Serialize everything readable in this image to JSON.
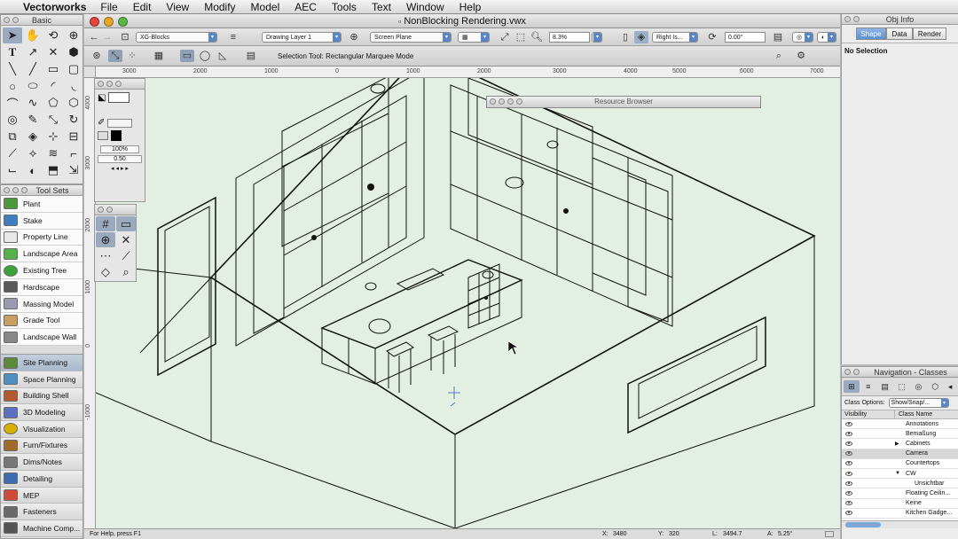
{
  "menubar": {
    "app": "Vectorworks",
    "items": [
      "File",
      "Edit",
      "View",
      "Modify",
      "Model",
      "AEC",
      "Tools",
      "Text",
      "Window",
      "Help"
    ]
  },
  "basic_palette": {
    "title": "Basic"
  },
  "toolsets_palette": {
    "title": "Tool Sets",
    "tools": [
      {
        "label": "Plant",
        "color": "#4a9a3c"
      },
      {
        "label": "Stake",
        "color": "#3f7fbf"
      },
      {
        "label": "Property Line",
        "color": "#7a7a7a"
      },
      {
        "label": "Landscape Area",
        "color": "#54b24a"
      },
      {
        "label": "Existing Tree",
        "color": "#3da23a"
      },
      {
        "label": "Hardscape",
        "color": "#5a5a5a"
      },
      {
        "label": "Massing Model",
        "color": "#9a9ab0"
      },
      {
        "label": "Grade Tool",
        "color": "#8a6a3a"
      },
      {
        "label": "Landscape Wall",
        "color": "#888888"
      }
    ],
    "sets": [
      {
        "label": "Site Planning",
        "active": true,
        "color": "#5c8a3a"
      },
      {
        "label": "Space Planning",
        "color": "#4f8fbf"
      },
      {
        "label": "Building Shell",
        "color": "#b3582f"
      },
      {
        "label": "3D Modeling",
        "color": "#5d6fbf"
      },
      {
        "label": "Visualization",
        "color": "#d8b000"
      },
      {
        "label": "Furn/Fixtures",
        "color": "#a06a2a"
      },
      {
        "label": "Dims/Notes",
        "color": "#777777"
      },
      {
        "label": "Detailing",
        "color": "#3d6db0"
      },
      {
        "label": "MEP",
        "color": "#d04a3a"
      },
      {
        "label": "Fasteners",
        "color": "#6a6a6a"
      },
      {
        "label": "Machine Comp...",
        "color": "#555555"
      }
    ]
  },
  "attributes": {
    "zoom_value": "100%",
    "line_weight": "0.50"
  },
  "document": {
    "title": "NonBlocking Rendering.vwx",
    "class_popup": "XG-Blocks",
    "layer_popup": "Drawing Layer 1",
    "plane_popup": "Screen Plane",
    "zoom": "8.3%",
    "view_popup": "Right Is...",
    "rotation": "0.00°",
    "mode_hint": "Selection Tool: Rectangular Marquee Mode",
    "status_help": "For Help, press F1",
    "status_x_label": "X:",
    "status_x": "3480",
    "status_y_label": "Y:",
    "status_y": "320",
    "status_l_label": "L:",
    "status_l": "3494.7",
    "status_a_label": "A:",
    "status_a": "5.25°"
  },
  "rulers": {
    "h_labels": [
      "3000",
      "2000",
      "1000",
      "0",
      "1000",
      "2000",
      "3000",
      "4000",
      "5000",
      "6000",
      "7000"
    ],
    "v_labels": [
      "4000",
      "3000",
      "2000",
      "1000",
      "0",
      "-1000"
    ]
  },
  "resource_browser": {
    "title": "Resource Browser"
  },
  "obj_info": {
    "title": "Obj Info",
    "tabs": [
      "Shape",
      "Data",
      "Render"
    ],
    "active_tab": "Shape",
    "selection": "No Selection"
  },
  "navigation": {
    "title": "Navigation - Classes",
    "class_options_label": "Class Options:",
    "class_options_value": "Show/Snap/...",
    "col_visibility": "Visibility",
    "col_class": "Class Name",
    "classes": [
      {
        "name": "Annotations",
        "indent": 0,
        "arrow": ""
      },
      {
        "name": "Bemaßung",
        "indent": 0,
        "arrow": ""
      },
      {
        "name": "Cabinets",
        "indent": 0,
        "arrow": "▶"
      },
      {
        "name": "Camera",
        "indent": 0,
        "arrow": "",
        "selected": true
      },
      {
        "name": "Countertops",
        "indent": 0,
        "arrow": ""
      },
      {
        "name": "CW",
        "indent": 0,
        "arrow": "▼"
      },
      {
        "name": "Unsichtbar",
        "indent": 1,
        "arrow": ""
      },
      {
        "name": "Floating Ceilin...",
        "indent": 0,
        "arrow": ""
      },
      {
        "name": "Keine",
        "indent": 0,
        "arrow": ""
      },
      {
        "name": "Kitchen Gadge...",
        "indent": 0,
        "arrow": ""
      }
    ]
  }
}
